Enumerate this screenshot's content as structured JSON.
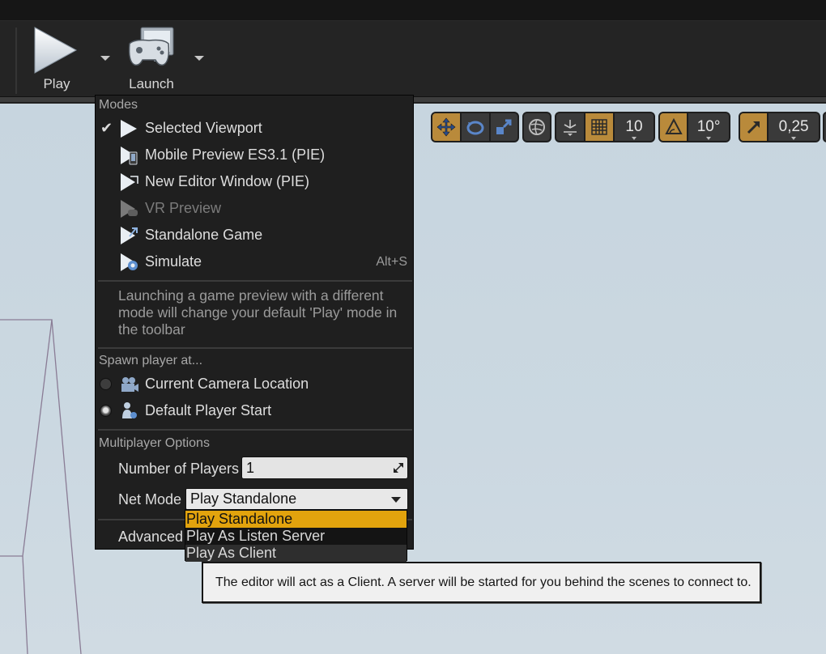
{
  "toolbar": {
    "play_label": "Play",
    "launch_label": "Launch"
  },
  "viewport_tools": {
    "grid_snap": "10",
    "rotation_snap": "10°",
    "scale_snap": "0,25"
  },
  "play_menu": {
    "modes_header": "Modes",
    "modes": [
      {
        "label": "Selected Viewport",
        "icon": "play-icon",
        "checked": true,
        "enabled": true,
        "shortcut": ""
      },
      {
        "label": "Mobile Preview ES3.1 (PIE)",
        "icon": "mobile-preview-icon",
        "checked": false,
        "enabled": true,
        "shortcut": ""
      },
      {
        "label": "New Editor Window (PIE)",
        "icon": "new-window-icon",
        "checked": false,
        "enabled": true,
        "shortcut": ""
      },
      {
        "label": "VR Preview",
        "icon": "vr-preview-icon",
        "checked": false,
        "enabled": false,
        "shortcut": ""
      },
      {
        "label": "Standalone Game",
        "icon": "standalone-game-icon",
        "checked": false,
        "enabled": true,
        "shortcut": ""
      },
      {
        "label": "Simulate",
        "icon": "simulate-icon",
        "checked": false,
        "enabled": true,
        "shortcut": "Alt+S"
      }
    ],
    "modes_note": "Launching a game preview with a different mode will change your default 'Play' mode in the toolbar",
    "spawn_header": "Spawn player at...",
    "spawn_options": [
      {
        "label": "Current Camera Location",
        "icon": "camera-icon",
        "selected": false
      },
      {
        "label": "Default Player Start",
        "icon": "player-start-icon",
        "selected": true
      }
    ],
    "multiplayer_header": "Multiplayer Options",
    "num_players_label": "Number of Players",
    "num_players_value": "1",
    "net_mode_label": "Net Mode",
    "net_mode_value": "Play Standalone",
    "advanced_label": "Advanced"
  },
  "net_mode_options": [
    {
      "label": "Play Standalone",
      "state": "selected"
    },
    {
      "label": "Play As Listen Server",
      "state": "normal"
    },
    {
      "label": "Play As Client",
      "state": "hovered"
    }
  ],
  "tooltip": {
    "text": "The editor will act as a Client. A server will be started for you behind the scenes to connect to."
  },
  "colors": {
    "accent": "#e2a30d",
    "toggle_on": "#b98a3b",
    "menu_bg": "#1f1f1f"
  }
}
